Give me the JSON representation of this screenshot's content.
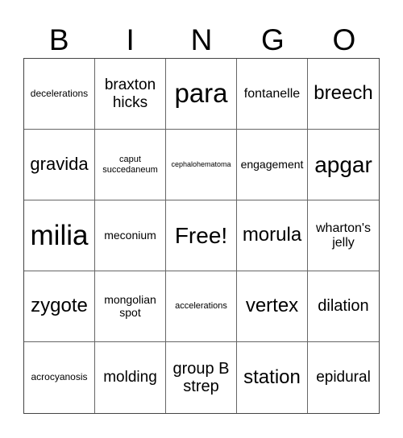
{
  "header": [
    "B",
    "I",
    "N",
    "G",
    "O"
  ],
  "cells": [
    [
      "decelerations",
      "braxton hicks",
      "para",
      "fontanelle",
      "breech"
    ],
    [
      "gravida",
      "caput succedaneum",
      "cephalohematoma",
      "engagement",
      "apgar"
    ],
    [
      "milia",
      "meconium",
      "Free!",
      "morula",
      "wharton's jelly"
    ],
    [
      "zygote",
      "mongolian spot",
      "accelerations",
      "vertex",
      "dilation"
    ],
    [
      "acrocyanosis",
      "molding",
      "group B strep",
      "station",
      "epidural"
    ]
  ]
}
